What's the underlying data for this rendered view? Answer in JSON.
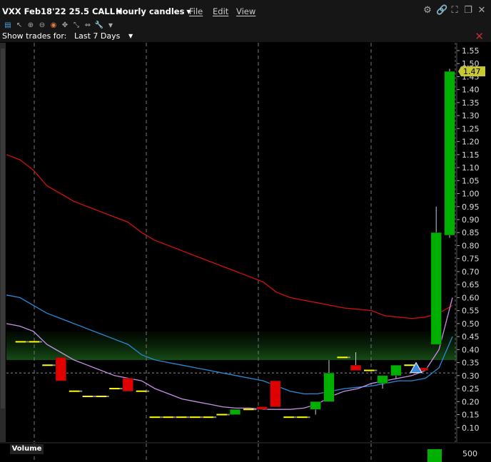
{
  "header": {
    "title": "VXX Feb18'22 25.5 CALL",
    "timeframe": "Hourly candles",
    "menu": [
      "File",
      "Edit",
      "View"
    ]
  },
  "show_trades": {
    "label": "Show trades for:",
    "value": "Last 7 Days"
  },
  "volume_panel": {
    "label": "Volume",
    "tick": "500"
  },
  "colors": {
    "up": "#00b000",
    "down": "#e00000",
    "flat": "#ffff00",
    "ma_red": "#d01010",
    "ma_blue": "#2a8ad8",
    "ma_violet": "#c890e8",
    "price_badge": "#c8c832",
    "background": "#000000"
  },
  "chart_data": {
    "type": "candlestick",
    "y_axis": {
      "ticks": [
        0.1,
        0.15,
        0.2,
        0.25,
        0.3,
        0.35,
        0.4,
        0.45,
        0.5,
        0.55,
        0.6,
        0.65,
        0.7,
        0.75,
        0.8,
        0.85,
        0.9,
        0.95,
        1.0,
        1.05,
        1.1,
        1.15,
        1.2,
        1.25,
        1.3,
        1.35,
        1.4,
        1.45,
        1.5,
        1.55
      ],
      "labels": [
        "0.10",
        "0.15",
        "0.20",
        "0.25",
        "0.30",
        "0.35",
        "0.40",
        "0.45",
        "0.50",
        "0.55",
        "0.60",
        "0.65",
        "0.70",
        "0.75",
        "0.80",
        "0.85",
        "0.90",
        "0.95",
        "1.00",
        "1.05",
        "1.10",
        "1.15",
        "1.20",
        "1.25",
        "1.30",
        "1.35",
        "1.40",
        "1.45",
        "1.50",
        "1.55"
      ],
      "range": [
        0.05,
        1.58
      ]
    },
    "last_price": "1.47",
    "reference_line": 0.31,
    "candles": [
      {
        "o": 0.43,
        "h": 0.43,
        "l": 0.43,
        "c": 0.43
      },
      {
        "o": 0.43,
        "h": 0.43,
        "l": 0.43,
        "c": 0.43
      },
      {
        "o": 0.34,
        "h": 0.34,
        "l": 0.34,
        "c": 0.34
      },
      {
        "o": 0.37,
        "h": 0.37,
        "l": 0.28,
        "c": 0.28
      },
      {
        "o": 0.24,
        "h": 0.24,
        "l": 0.24,
        "c": 0.24
      },
      {
        "o": 0.22,
        "h": 0.22,
        "l": 0.22,
        "c": 0.22
      },
      {
        "o": 0.22,
        "h": 0.22,
        "l": 0.22,
        "c": 0.22
      },
      {
        "o": 0.25,
        "h": 0.25,
        "l": 0.25,
        "c": 0.25
      },
      {
        "o": 0.29,
        "h": 0.29,
        "l": 0.24,
        "c": 0.24
      },
      {
        "o": 0.24,
        "h": 0.24,
        "l": 0.24,
        "c": 0.24
      },
      {
        "o": 0.14,
        "h": 0.14,
        "l": 0.14,
        "c": 0.14
      },
      {
        "o": 0.14,
        "h": 0.14,
        "l": 0.14,
        "c": 0.14
      },
      {
        "o": 0.14,
        "h": 0.14,
        "l": 0.14,
        "c": 0.14
      },
      {
        "o": 0.14,
        "h": 0.14,
        "l": 0.14,
        "c": 0.14
      },
      {
        "o": 0.14,
        "h": 0.14,
        "l": 0.14,
        "c": 0.14
      },
      {
        "o": 0.15,
        "h": 0.15,
        "l": 0.15,
        "c": 0.15
      },
      {
        "o": 0.15,
        "h": 0.17,
        "l": 0.15,
        "c": 0.17
      },
      {
        "o": 0.17,
        "h": 0.17,
        "l": 0.17,
        "c": 0.17
      },
      {
        "o": 0.18,
        "h": 0.18,
        "l": 0.17,
        "c": 0.17
      },
      {
        "o": 0.28,
        "h": 0.28,
        "l": 0.18,
        "c": 0.18
      },
      {
        "o": 0.14,
        "h": 0.15,
        "l": 0.14,
        "c": 0.14
      },
      {
        "o": 0.14,
        "h": 0.14,
        "l": 0.14,
        "c": 0.14
      },
      {
        "o": 0.17,
        "h": 0.2,
        "l": 0.15,
        "c": 0.2
      },
      {
        "o": 0.2,
        "h": 0.36,
        "l": 0.2,
        "c": 0.31
      },
      {
        "o": 0.37,
        "h": 0.37,
        "l": 0.37,
        "c": 0.37
      },
      {
        "o": 0.34,
        "h": 0.39,
        "l": 0.32,
        "c": 0.32
      },
      {
        "o": 0.32,
        "h": 0.32,
        "l": 0.32,
        "c": 0.32
      },
      {
        "o": 0.27,
        "h": 0.3,
        "l": 0.25,
        "c": 0.3
      },
      {
        "o": 0.3,
        "h": 0.34,
        "l": 0.29,
        "c": 0.34
      },
      {
        "o": 0.34,
        "h": 0.35,
        "l": 0.3,
        "c": 0.34
      },
      {
        "o": 0.33,
        "h": 0.33,
        "l": 0.32,
        "c": 0.32
      },
      {
        "o": 0.42,
        "h": 0.95,
        "l": 0.42,
        "c": 0.85
      },
      {
        "o": 0.84,
        "h": 1.48,
        "l": 0.83,
        "c": 1.47
      }
    ],
    "moving_averages": [
      {
        "color": "ma_red",
        "values": [
          1.15,
          1.13,
          1.09,
          1.03,
          1.0,
          0.97,
          0.95,
          0.93,
          0.91,
          0.89,
          0.85,
          0.82,
          0.8,
          0.78,
          0.76,
          0.74,
          0.72,
          0.7,
          0.68,
          0.66,
          0.62,
          0.6,
          0.59,
          0.58,
          0.57,
          0.56,
          0.555,
          0.55,
          0.53,
          0.525,
          0.52,
          0.525,
          0.54,
          0.57
        ]
      },
      {
        "color": "ma_blue",
        "values": [
          0.61,
          0.6,
          0.57,
          0.54,
          0.52,
          0.5,
          0.48,
          0.46,
          0.44,
          0.42,
          0.38,
          0.36,
          0.35,
          0.34,
          0.33,
          0.32,
          0.31,
          0.3,
          0.29,
          0.28,
          0.26,
          0.24,
          0.23,
          0.23,
          0.24,
          0.25,
          0.255,
          0.26,
          0.27,
          0.28,
          0.28,
          0.29,
          0.33,
          0.45
        ]
      },
      {
        "color": "ma_violet",
        "values": [
          0.5,
          0.49,
          0.47,
          0.42,
          0.39,
          0.36,
          0.34,
          0.32,
          0.3,
          0.29,
          0.28,
          0.25,
          0.23,
          0.21,
          0.2,
          0.19,
          0.18,
          0.175,
          0.175,
          0.17,
          0.17,
          0.17,
          0.175,
          0.19,
          0.22,
          0.24,
          0.25,
          0.27,
          0.28,
          0.29,
          0.3,
          0.32,
          0.4,
          0.6
        ]
      }
    ],
    "markers": [
      {
        "type": "triangle-up",
        "index": 29,
        "value": 0.325
      }
    ],
    "grid": {
      "vertical_dashed": true
    }
  }
}
